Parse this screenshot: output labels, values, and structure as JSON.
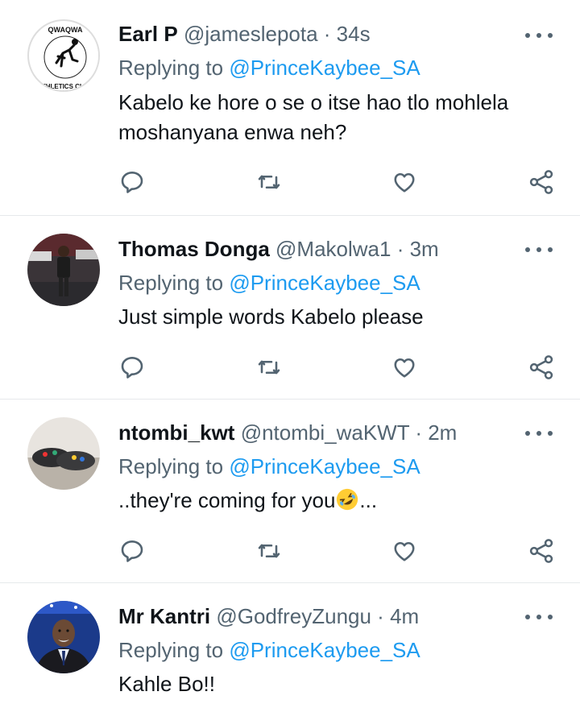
{
  "tweets": [
    {
      "name": "Earl P",
      "meta": "@jameslepota · 34s",
      "reply_prefix": "Replying to",
      "reply_handle": "@PrinceKaybee_SA",
      "text": "Kabelo ke hore o se o itse hao tlo  mohlela moshanyana enwa neh?",
      "avatar_logo_text": [
        "QWAQWA",
        "ATHLETICS CLUB"
      ],
      "avatar": "athletics-club-logo"
    },
    {
      "name": "Thomas Donga",
      "meta": "@Makolwa1 · 3m",
      "reply_prefix": "Replying to",
      "reply_handle": "@PrinceKaybee_SA",
      "text": "Just simple words Kabelo please",
      "avatar": "man-photo"
    },
    {
      "name": "ntombi_kwt",
      "meta": "@ntombi_waKWT · 2m",
      "reply_prefix": "Replying to",
      "reply_handle": "@PrinceKaybee_SA",
      "text": "..they're coming for you",
      "text_suffix": "...",
      "emoji": "rolling-on-floor-laughing",
      "avatar": "shoes-photo"
    },
    {
      "name": "Mr Kantri",
      "meta": "@GodfreyZungu · 4m",
      "reply_prefix": "Replying to",
      "reply_handle": "@PrinceKaybee_SA",
      "text": "Kahle Bo!!",
      "avatar": "man-in-suit-photo"
    }
  ],
  "action_icons": [
    "reply-icon",
    "retweet-icon",
    "like-icon",
    "share-icon"
  ],
  "colors": {
    "text": "#0f1419",
    "secondary": "#536471",
    "link": "#1d9bf0",
    "divider": "#e6e9eb"
  }
}
